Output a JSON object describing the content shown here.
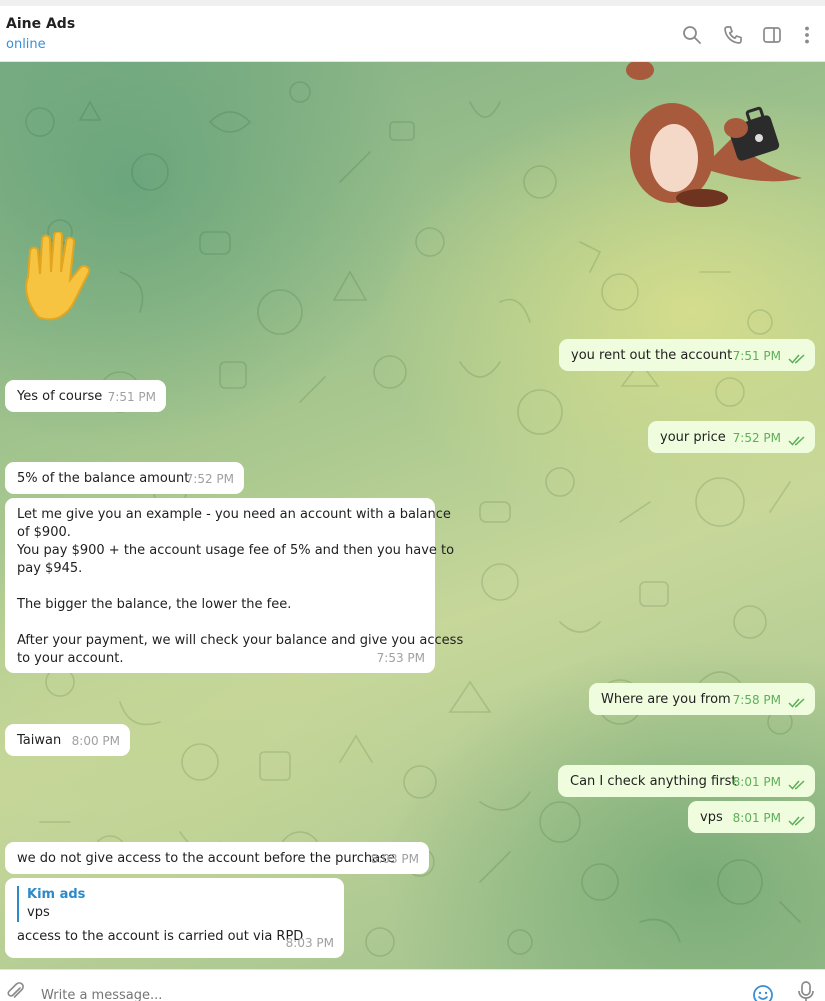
{
  "header": {
    "title": "Aine Ads",
    "status": "online",
    "icons": [
      "search-icon",
      "phone-icon",
      "sidebar-toggle-icon",
      "more-vert-icon"
    ]
  },
  "messages": [
    {
      "dir": "out",
      "text": "you rent out the account",
      "time": "7:51 PM",
      "read": true
    },
    {
      "dir": "in",
      "text": "Yes of course",
      "time": "7:51 PM"
    },
    {
      "dir": "out",
      "text": "your price",
      "time": "7:52 PM",
      "read": true
    },
    {
      "dir": "in",
      "text": "5% of the balance amount",
      "time": "7:52 PM"
    },
    {
      "dir": "in",
      "lines": [
        "Let me give you an example - you need an account with a balance",
        "of $900.",
        "You pay $900 + the account usage fee of 5% and then you have to",
        "pay $945.",
        "",
        "The bigger the balance, the lower the fee.",
        "",
        "After your payment, we will check your balance and give you access",
        "to your account."
      ],
      "time": "7:53 PM"
    },
    {
      "dir": "out",
      "text": "Where are you from",
      "time": "7:58 PM",
      "read": true
    },
    {
      "dir": "in",
      "text": "Taiwan",
      "time": "8:00 PM"
    },
    {
      "dir": "out",
      "text": "Can I check anything first",
      "time": "8:01 PM",
      "read": true
    },
    {
      "dir": "out",
      "text": "vps",
      "time": "8:01 PM",
      "read": true
    },
    {
      "dir": "in",
      "text": "we do not give access to the account before the purchase",
      "time": "8:03 PM"
    },
    {
      "dir": "in",
      "reply_to": {
        "name": "Kim ads",
        "text": "vps"
      },
      "text": "access to the account is carried out via RPD",
      "time": "8:03 PM"
    }
  ],
  "composer": {
    "placeholder": "Write a message..."
  },
  "colors": {
    "accent": "#3a8fd6",
    "out_bubble": "#effdde",
    "in_bubble": "#ffffff",
    "read_check": "#5fae5a"
  }
}
